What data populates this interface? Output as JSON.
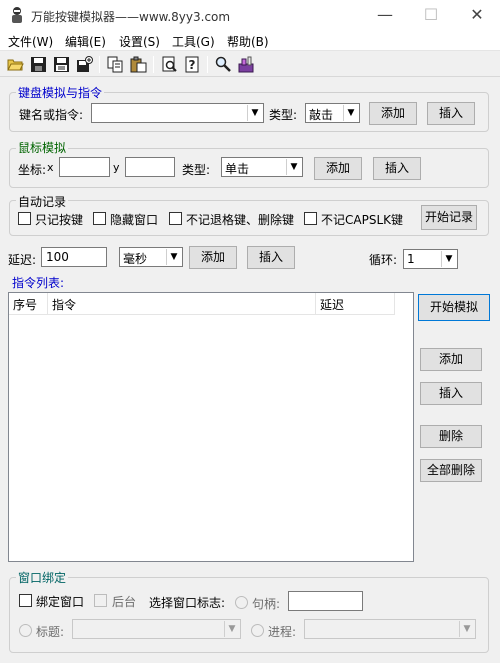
{
  "window": {
    "title": "万能按键模拟器——www.8yy3.com",
    "minimize_glyph": "—",
    "maximize_glyph": "☐",
    "close_glyph": "✕"
  },
  "menu": [
    "文件(W)",
    "编辑(E)",
    "设置(S)",
    "工具(G)",
    "帮助(B)"
  ],
  "toolbar_icons": [
    "open-folder-icon",
    "save-icon",
    "save-as-icon",
    "properties-icon",
    "copy-icon",
    "paste-icon",
    "print-preview-icon",
    "help-icon",
    "find-icon",
    "tools-icon"
  ],
  "keyboard": {
    "title": "键盘模拟与指令",
    "key_label": "键名或指令:",
    "key_value": "",
    "type_label": "类型:",
    "type_value": "敲击",
    "add": "添加",
    "insert": "插入"
  },
  "mouse": {
    "title": "鼠标模拟",
    "coord_label": "坐标:",
    "x_label": "x",
    "x_value": "",
    "y_label": "y",
    "y_value": "",
    "type_label": "类型:",
    "type_value": "单击",
    "add": "添加",
    "insert": "插入"
  },
  "auto_record": {
    "title": "自动记录",
    "options": [
      "只记按键",
      "隐藏窗口",
      "不记退格键、删除键",
      "不记CAPSLK键"
    ],
    "start": "开始记录"
  },
  "delay": {
    "label": "延迟:",
    "value": "100",
    "unit": "毫秒",
    "add": "添加",
    "insert": "插入",
    "loop_label": "循环:",
    "loop_value": "1"
  },
  "list": {
    "title": "指令列表:",
    "columns": [
      "序号",
      "指令",
      "延迟"
    ],
    "rows": []
  },
  "side_buttons": {
    "start_sim": "开始模拟",
    "add": "添加",
    "insert": "插入",
    "delete": "删除",
    "delete_all": "全部删除"
  },
  "bind": {
    "title": "窗口绑定",
    "bind_window": "绑定窗口",
    "background": "后台",
    "select_flag": "选择窗口标志:",
    "handle": "句柄:",
    "handle_value": "",
    "title_label": "标题:",
    "title_value": "",
    "process": "进程:",
    "process_value": ""
  },
  "colors": {
    "group_title_blue": "#0000cc",
    "group_title_green": "#006400",
    "focus_border": "#0078d7"
  }
}
